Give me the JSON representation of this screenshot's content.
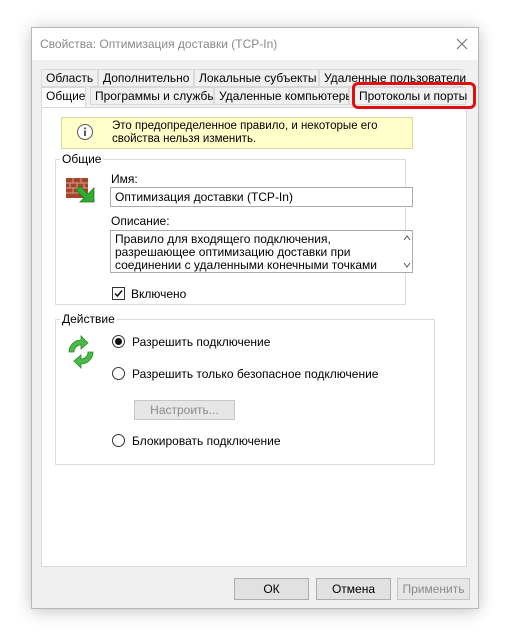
{
  "window": {
    "title": "Свойства: Оптимизация доставки (TCP-In)"
  },
  "tabs": {
    "row1": [
      "Область",
      "Дополнительно",
      "Локальные субъекты",
      "Удаленные пользователи"
    ],
    "row2": [
      "Общие",
      "Программы и службы",
      "Удаленные компьютеры",
      "Протоколы и порты"
    ],
    "active": "Общие",
    "highlighted": "Протоколы и порты"
  },
  "info": {
    "text": "Это предопределенное правило, и некоторые его свойства нельзя изменить."
  },
  "general": {
    "group_label": "Общие",
    "name_label": "Имя:",
    "name_value": "Оптимизация доставки (TCP-In)",
    "desc_label": "Описание:",
    "desc_value": "Правило для входящего подключения, разрешающее оптимизацию доставки при соединении с удаленными конечными точками",
    "enabled_label": "Включено",
    "enabled": true
  },
  "action": {
    "group_label": "Действие",
    "allow_label": "Разрешить подключение",
    "secure_label": "Разрешить только безопасное подключение",
    "configure_label": "Настроить...",
    "block_label": "Блокировать подключение",
    "selected": "allow"
  },
  "footer": {
    "ok_label": "ОК",
    "cancel_label": "Отмена",
    "apply_label": "Применить"
  },
  "colors": {
    "highlight": "#e01010",
    "info_bg": "#ffffc9",
    "dialog_bg": "#f0f0f0"
  }
}
